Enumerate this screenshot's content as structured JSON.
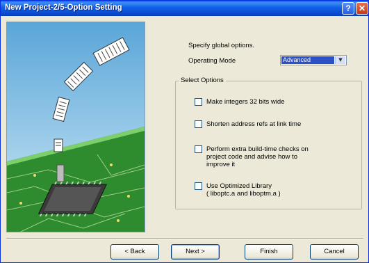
{
  "window": {
    "title": "New Project-2/5-Option Setting"
  },
  "main": {
    "prompt": "Specify global options.",
    "operating_mode_label": "Operating Mode",
    "operating_mode_value": "Advanced"
  },
  "options": {
    "group_title": "Select Options",
    "items": [
      {
        "lines": [
          "Make integers 32 bits wide"
        ],
        "checked": false
      },
      {
        "lines": [
          "Shorten address refs at link time"
        ],
        "checked": false
      },
      {
        "lines": [
          "Perform extra build-time checks on",
          "project code and advise how to",
          "improve it"
        ],
        "checked": false
      },
      {
        "lines": [
          "Use Optimized Library",
          "( liboptc.a and liboptm.a )"
        ],
        "checked": false
      }
    ]
  },
  "buttons": {
    "back": "< Back",
    "next": "Next >",
    "finish": "Finish",
    "cancel": "Cancel"
  },
  "colors": {
    "titlebar": "#0846c9",
    "selection": "#2b50c8",
    "pcb_green": "#2e8b2e",
    "sky": "#8ec6e8"
  }
}
